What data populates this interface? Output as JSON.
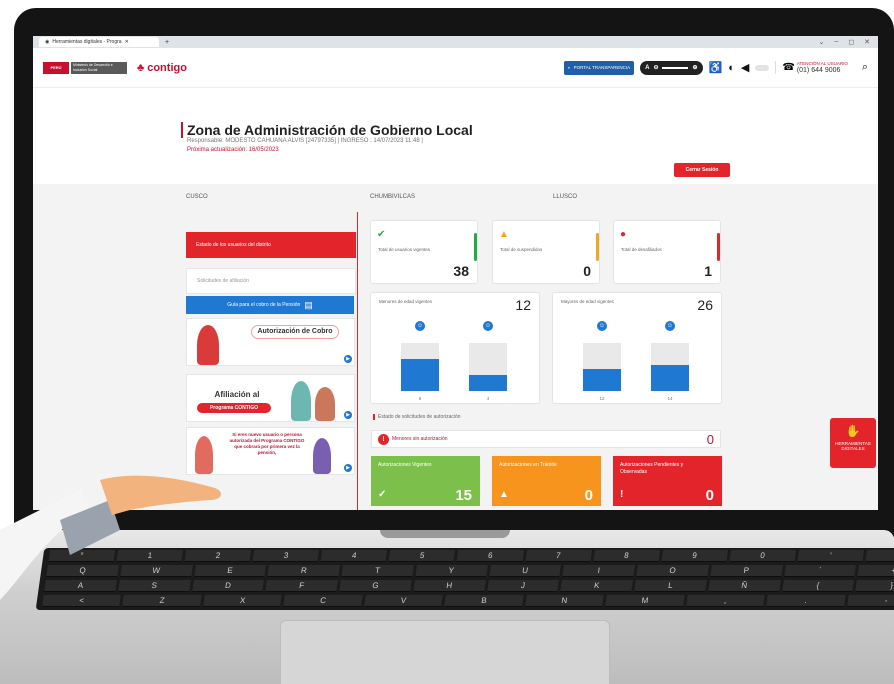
{
  "browser": {
    "tab_title": "Herramientas digitales - Progra",
    "new_tab": "+",
    "controls": [
      "⌄",
      "–",
      "◻",
      "✕"
    ]
  },
  "topbar": {
    "gov_flag": "PERÚ",
    "ministry": "Ministerio de Desarrollo e Inclusión Social",
    "brand": "contigo",
    "portal_label": "PORTAL TRANSPARENCIA",
    "zoom_label": "A",
    "support_label": "ATENCIÓN AL USUARIO",
    "support_phone": "(01) 644 9006"
  },
  "header": {
    "title": "Zona de Administración de Gobierno Local",
    "responsable": "Responsable: MODESTO CAHUANA ALVIS [24797335] | INGRESO : 14/07/2023 11:48 |",
    "next_update": "Próxima actualización: 16/05/2023",
    "logout": "Cerrar Sesión"
  },
  "locations": [
    "CUSCO",
    "CHUMBIVILCAS",
    "LLUSCO"
  ],
  "sidebar": {
    "active": "Estado de los usuarios del distrito",
    "inactive": "Solicitudes de afiliación",
    "guide": "Guía para el cobro de la Pensión"
  },
  "banners": [
    {
      "title": "Autorización de Cobro"
    },
    {
      "title": "Afiliación al",
      "subtitle": "Programa CONTIGO"
    },
    {
      "title": "Si eres nuevo usuario o persona autorizada del Programa CONTIGO que cobrará por primera vez la pensión,"
    }
  ],
  "stats": [
    {
      "label": "Total de usuarios vigentes",
      "value": "38",
      "color": "#27a844"
    },
    {
      "label": "Total de suspendidos",
      "value": "0",
      "color": "#f0a81f"
    },
    {
      "label": "Total de desafiliados",
      "value": "1",
      "color": "#e3242b"
    }
  ],
  "charts": [
    {
      "title": "Menores de edad vigentes",
      "total": "12",
      "bars": [
        {
          "label": "8",
          "fill": 0.67
        },
        {
          "label": "4",
          "fill": 0.33
        }
      ]
    },
    {
      "title": "Mayores de edad vigentes",
      "total": "26",
      "bars": [
        {
          "label": "12",
          "fill": 0.46
        },
        {
          "label": "14",
          "fill": 0.54
        }
      ]
    }
  ],
  "authorizations": {
    "title": "Estado de solicitudes de autorización",
    "missing_label": "Menores sin autorización",
    "missing_value": "0",
    "boxes": [
      {
        "label": "Autorizaciones Vigentes",
        "value": "15",
        "color": "#7cc04b",
        "icon": "✓"
      },
      {
        "label": "Autorizaciones en Trámite",
        "value": "0",
        "color": "#f7941d",
        "icon": "▲"
      },
      {
        "label": "Autorizaciones Pendientes y Observadas",
        "value": "0",
        "color": "#e3242b",
        "icon": "!"
      }
    ]
  },
  "fab": {
    "label": "HERRAMIENTAS DIGITALES"
  },
  "keyboard": {
    "row1": [
      "°",
      "1",
      "2",
      "3",
      "4",
      "5",
      "6",
      "7",
      "8",
      "9",
      "0",
      "'",
      "¿"
    ],
    "row2": [
      "Q",
      "W",
      "E",
      "R",
      "T",
      "Y",
      "U",
      "I",
      "O",
      "P",
      "´",
      "+"
    ],
    "row3": [
      "A",
      "S",
      "D",
      "F",
      "G",
      "H",
      "J",
      "K",
      "L",
      "Ñ",
      "{",
      "}"
    ],
    "row4": [
      "<",
      "Z",
      "X",
      "C",
      "V",
      "B",
      "N",
      "M",
      ",",
      ".",
      "-"
    ]
  }
}
